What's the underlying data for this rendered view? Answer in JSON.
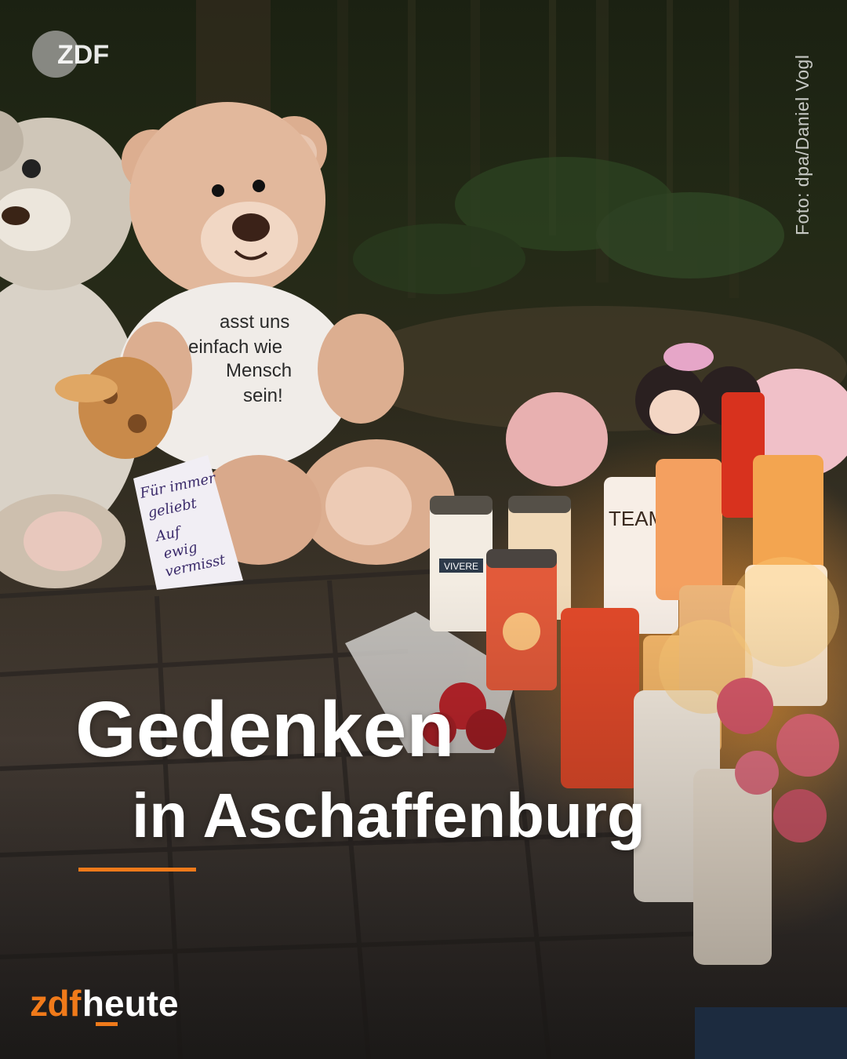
{
  "photo": {
    "credit": "Foto: dpa/Daniel Vogl",
    "shirt_text": [
      "asst uns",
      "einfach wie",
      "Mensch",
      "sein!"
    ],
    "card_text": [
      "Für immer",
      "geliebt",
      "Auf",
      "ewig",
      "vermisst"
    ],
    "candle_labels": [
      "VIVERE",
      "TEAM"
    ]
  },
  "broadcaster_logo": {
    "label": "ZDF",
    "icon": "zdf-logo-icon"
  },
  "headline": {
    "title": "Gedenken",
    "subtitle": "in Aschaffenburg"
  },
  "brand": {
    "part1": "zdf",
    "part2": "heute"
  },
  "colors": {
    "accent": "#f07a1a",
    "corner_block": "#1c2b3f",
    "text": "#ffffff"
  }
}
